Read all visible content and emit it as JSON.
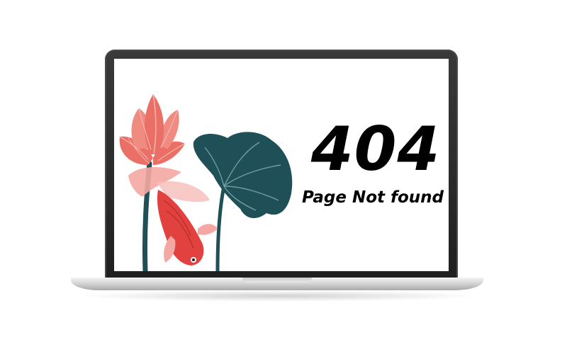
{
  "error": {
    "code": "404",
    "message": "Page Not found"
  },
  "colors": {
    "lotus_petal": "#ea6f66",
    "lotus_petal_light": "#f7b7ae",
    "leaf": "#1f4f57",
    "leaf_vein": "#6f9ea3",
    "fish": "#e2423f",
    "fish_fin": "#f4a7a3",
    "bezel": "#1f1f1f",
    "text": "#000000"
  },
  "illustration": {
    "icons": [
      "lotus-flower-icon",
      "lotus-leaf-icon",
      "koi-fish-icon"
    ]
  }
}
